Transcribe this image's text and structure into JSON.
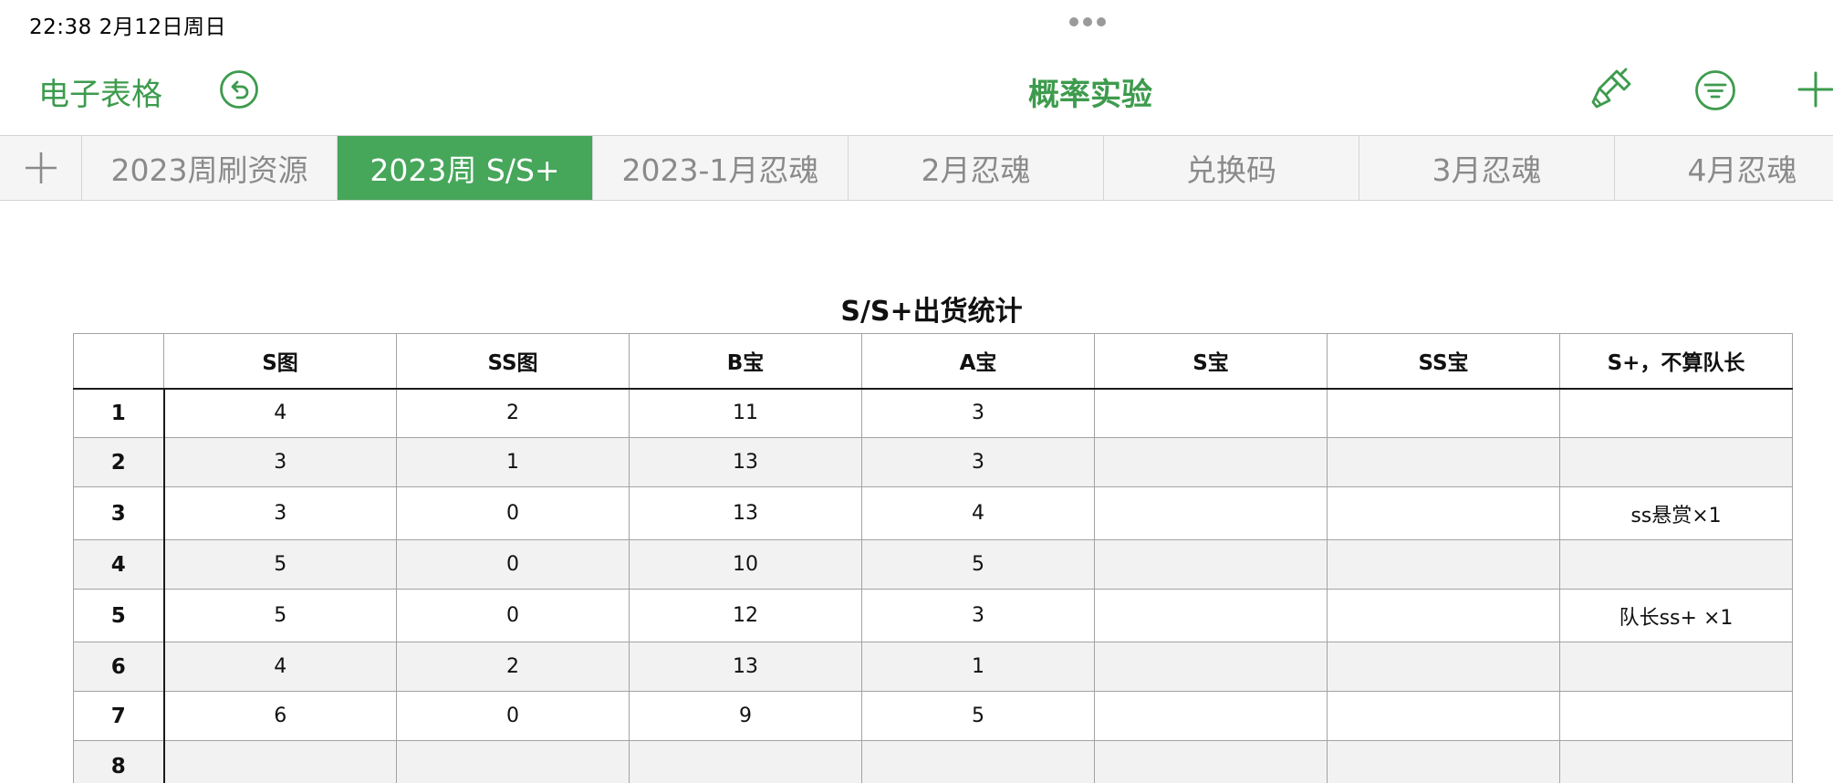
{
  "status_bar": {
    "time_date": "22:38   2月12日周日"
  },
  "toolbar": {
    "app_title": "电子表格",
    "doc_title": "概率实验",
    "icons": [
      "undo-icon",
      "paintbrush-icon",
      "filter-icon",
      "plus-icon"
    ]
  },
  "tabs": [
    {
      "label": "2023周刷资源",
      "active": false
    },
    {
      "label": "2023周 S/S+",
      "active": true
    },
    {
      "label": "2023-1月忍魂",
      "active": false
    },
    {
      "label": "2月忍魂",
      "active": false
    },
    {
      "label": "兑换码",
      "active": false
    },
    {
      "label": "3月忍魂",
      "active": false
    },
    {
      "label": "4月忍魂",
      "active": false
    }
  ],
  "sheet": {
    "title": "S/S+出货统计",
    "columns": [
      "",
      "S图",
      "SS图",
      "B宝",
      "A宝",
      "S宝",
      "SS宝",
      "S+，不算队长"
    ],
    "rows": [
      [
        "1",
        "4",
        "2",
        "11",
        "3",
        "",
        "",
        ""
      ],
      [
        "2",
        "3",
        "1",
        "13",
        "3",
        "",
        "",
        ""
      ],
      [
        "3",
        "3",
        "0",
        "13",
        "4",
        "",
        "",
        "ss悬赏×1"
      ],
      [
        "4",
        "5",
        "0",
        "10",
        "5",
        "",
        "",
        ""
      ],
      [
        "5",
        "5",
        "0",
        "12",
        "3",
        "",
        "",
        "队长ss+ ×1"
      ],
      [
        "6",
        "4",
        "2",
        "13",
        "1",
        "",
        "",
        ""
      ],
      [
        "7",
        "6",
        "0",
        "9",
        "5",
        "",
        "",
        ""
      ],
      [
        "8",
        "",
        "",
        "",
        "",
        "",
        "",
        ""
      ]
    ]
  },
  "colors": {
    "accent": "#3d9b4d",
    "active_tab": "#46a65a",
    "tab_text": "#8a8a8a",
    "stripe": "#f2f2f2"
  }
}
